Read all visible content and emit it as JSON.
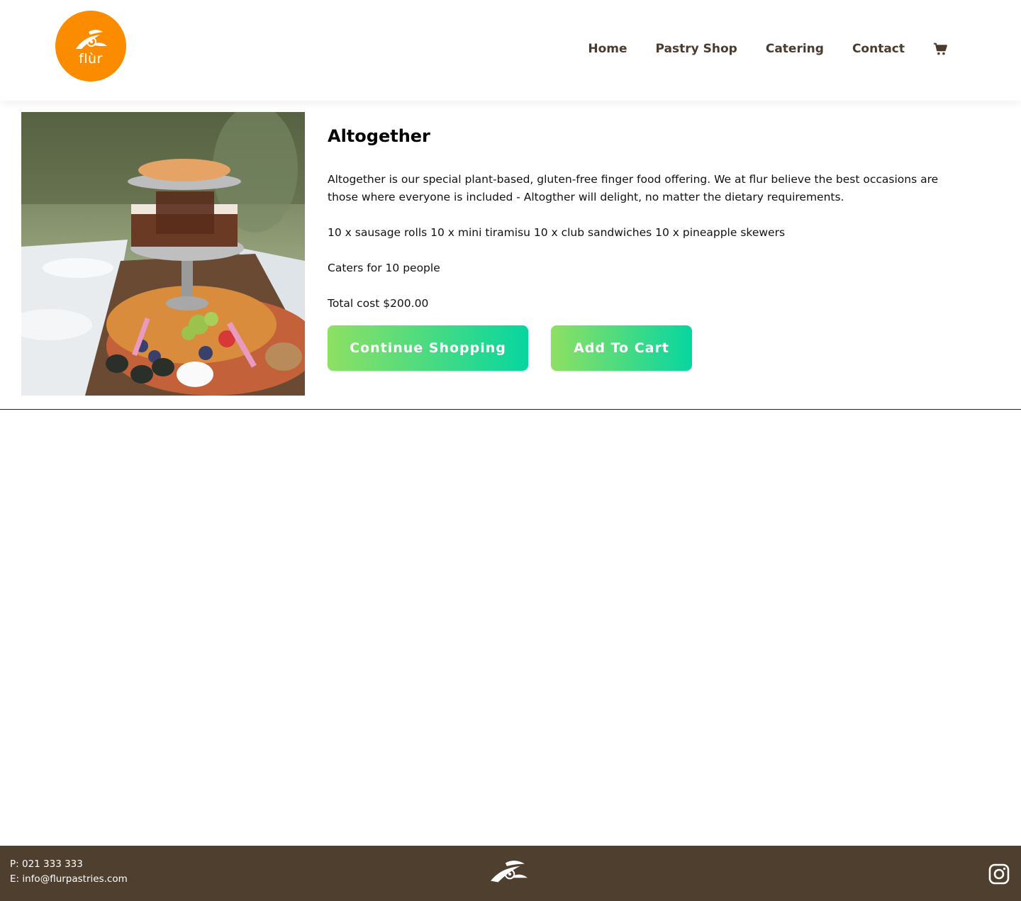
{
  "header": {
    "logo_text": "flùr",
    "nav": [
      "Home",
      "Pastry Shop",
      "Catering",
      "Contact"
    ],
    "cart_icon": "shopping-cart-icon",
    "accent_color": "#fb8c00"
  },
  "product": {
    "title": "Altogether",
    "description": "Altogether is our special plant-based, gluten-free finger food offering. We at flur believe the best occasions are those where everyone is included - Altogther will delight, no matter the dietary requirements.",
    "items": "10 x sausage rolls 10 x mini tiramisu 10 x club sandwiches 10 x pineapple skewers",
    "caters": "Caters for 10 people",
    "cost": "Total cost $200.00",
    "image": "food-platter-photo"
  },
  "buttons": {
    "continue_label": "Continue Shopping",
    "add_label": "Add To Cart",
    "gradient_start": "#8ee063",
    "gradient_end": "#06d6a0"
  },
  "footer": {
    "phone": "P: 021 333 333",
    "email": "E: info@flurpastries.com",
    "social_icon": "instagram-icon",
    "background": "#4f3f2f"
  }
}
